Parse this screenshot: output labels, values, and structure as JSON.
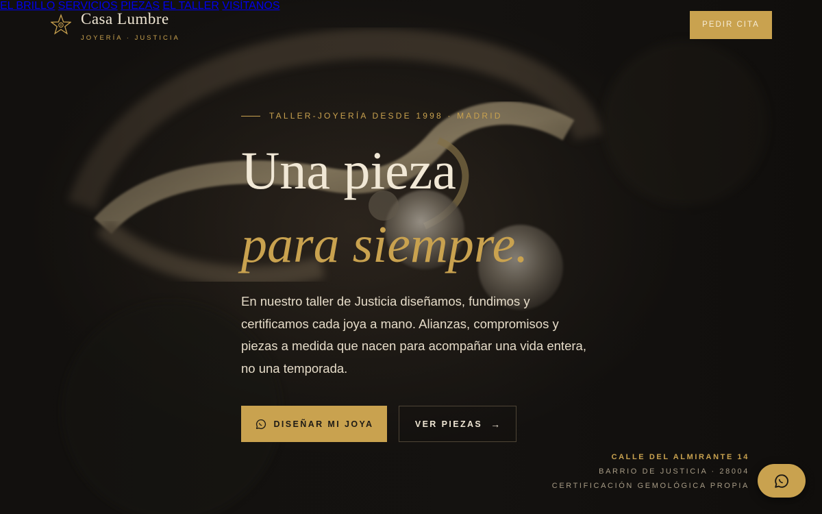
{
  "brand": {
    "name": "Casa Lumbre",
    "tagline": "JOYERÍA · JUSTICIA",
    "icon": "star-icon"
  },
  "nav": {
    "items": [
      {
        "label": "EL BRILLO"
      },
      {
        "label": "SERVICIOS"
      },
      {
        "label": "PIEZAS"
      },
      {
        "label": "EL TALLER"
      },
      {
        "label": "VISÍTANOS"
      }
    ],
    "cta_label": "PEDIR CITA"
  },
  "hero": {
    "eyebrow": "TALLER-JOYERÍA DESDE 1998 · MADRID",
    "title_line1": "Una pieza",
    "title_line2": "para siempre.",
    "lead": "En nuestro taller de Justicia diseñamos, fundimos y certificamos cada joya a mano. Alianzas, compromisos y piezas a medida que nacen para acompañar una vida entera, no una temporada.",
    "primary_button": "DISEÑAR MI JOYA",
    "primary_button_icon": "chat-icon",
    "secondary_button": "VER PIEZAS",
    "secondary_button_icon": "arrow-right-icon"
  },
  "address": {
    "line1": "CALLE DEL ALMIRANTE 14",
    "line2": "BARRIO DE JUSTICIA · 28004",
    "line3": "CERTIFICACIÓN GEMOLÓGICA PROPIA"
  },
  "chat": {
    "icon": "chat-icon"
  },
  "colors": {
    "accent": "#c9a24f",
    "background": "#151311",
    "text": "#efe6d4"
  }
}
